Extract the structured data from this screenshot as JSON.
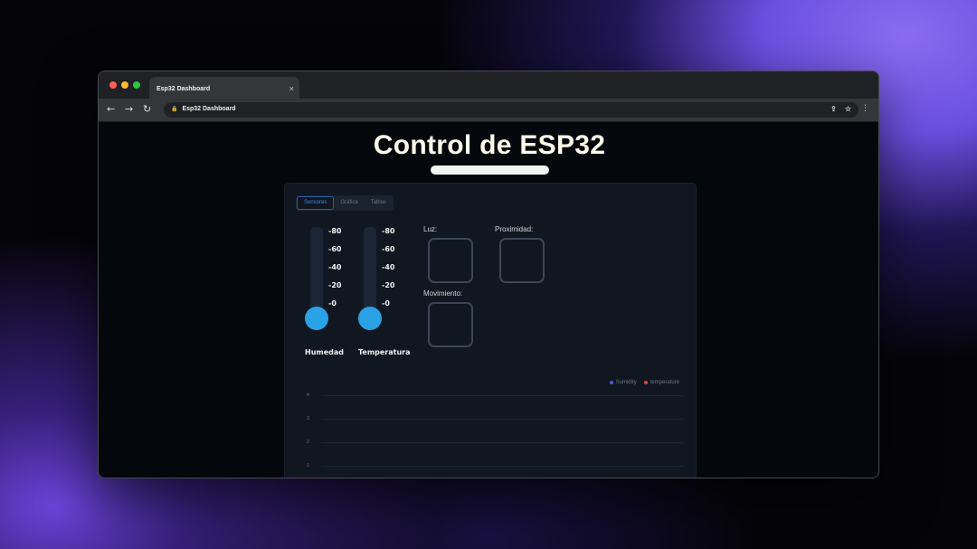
{
  "browser": {
    "tab_title": "Esp32 Dashboard",
    "tab_close": "×",
    "address": "Esp32 Dashboard",
    "window_dots": [
      "#ff5f57",
      "#febc2e",
      "#28c840"
    ],
    "nav": {
      "back": "←",
      "forward": "→",
      "reload": "↻"
    }
  },
  "page": {
    "title": "Control de ESP32"
  },
  "tabs": [
    {
      "label": "Sensores",
      "active": true
    },
    {
      "label": "Gráfica",
      "active": false
    },
    {
      "label": "Tablas",
      "active": false
    }
  ],
  "gauges": [
    {
      "label": "Humedad",
      "ticks": [
        "-80",
        "-60",
        "-40",
        "-20",
        "-0"
      ],
      "value": 0,
      "color": "#2aa3e6"
    },
    {
      "label": "Temperatura",
      "ticks": [
        "-80",
        "-60",
        "-40",
        "-20",
        "-0"
      ],
      "value": 0,
      "color": "#2aa3e6"
    }
  ],
  "sensors": {
    "luz": "Luz:",
    "proximidad": "Proximidad:",
    "movimiento": "Movimiento:"
  },
  "chart_data": {
    "type": "line",
    "series": [
      {
        "name": "humidity",
        "color": "#4f5bd5",
        "values": []
      },
      {
        "name": "temperature",
        "color": "#e0443a",
        "values": []
      }
    ],
    "y_ticks": [
      "4",
      "3",
      "2",
      "1"
    ],
    "legend_position": "top-right",
    "grid": true
  }
}
